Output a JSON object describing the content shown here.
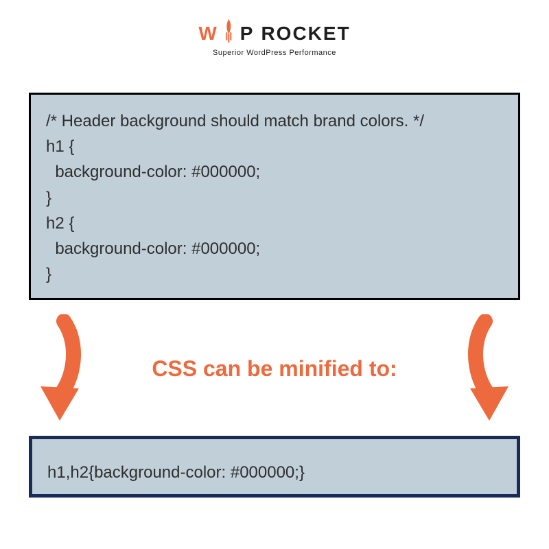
{
  "brand": {
    "logo_prefix": "W",
    "logo_suffix": "P",
    "logo_word": "ROCKET",
    "tagline": "Superior WordPress Performance",
    "accent": "#ed6a3e",
    "dark": "#1e1e1e"
  },
  "code_before": "/* Header background should match brand colors. */\nh1 {\n  background-color: #000000;\n}\nh2 {\n  background-color: #000000;\n}",
  "mid_label": "CSS can be minified to:",
  "code_after": "h1,h2{background-color: #000000;}",
  "colors": {
    "box_bg": "#c1cfd8",
    "box_border_before": "#000000",
    "box_border_after": "#1c2a58",
    "arrow": "#ed6a3e"
  }
}
